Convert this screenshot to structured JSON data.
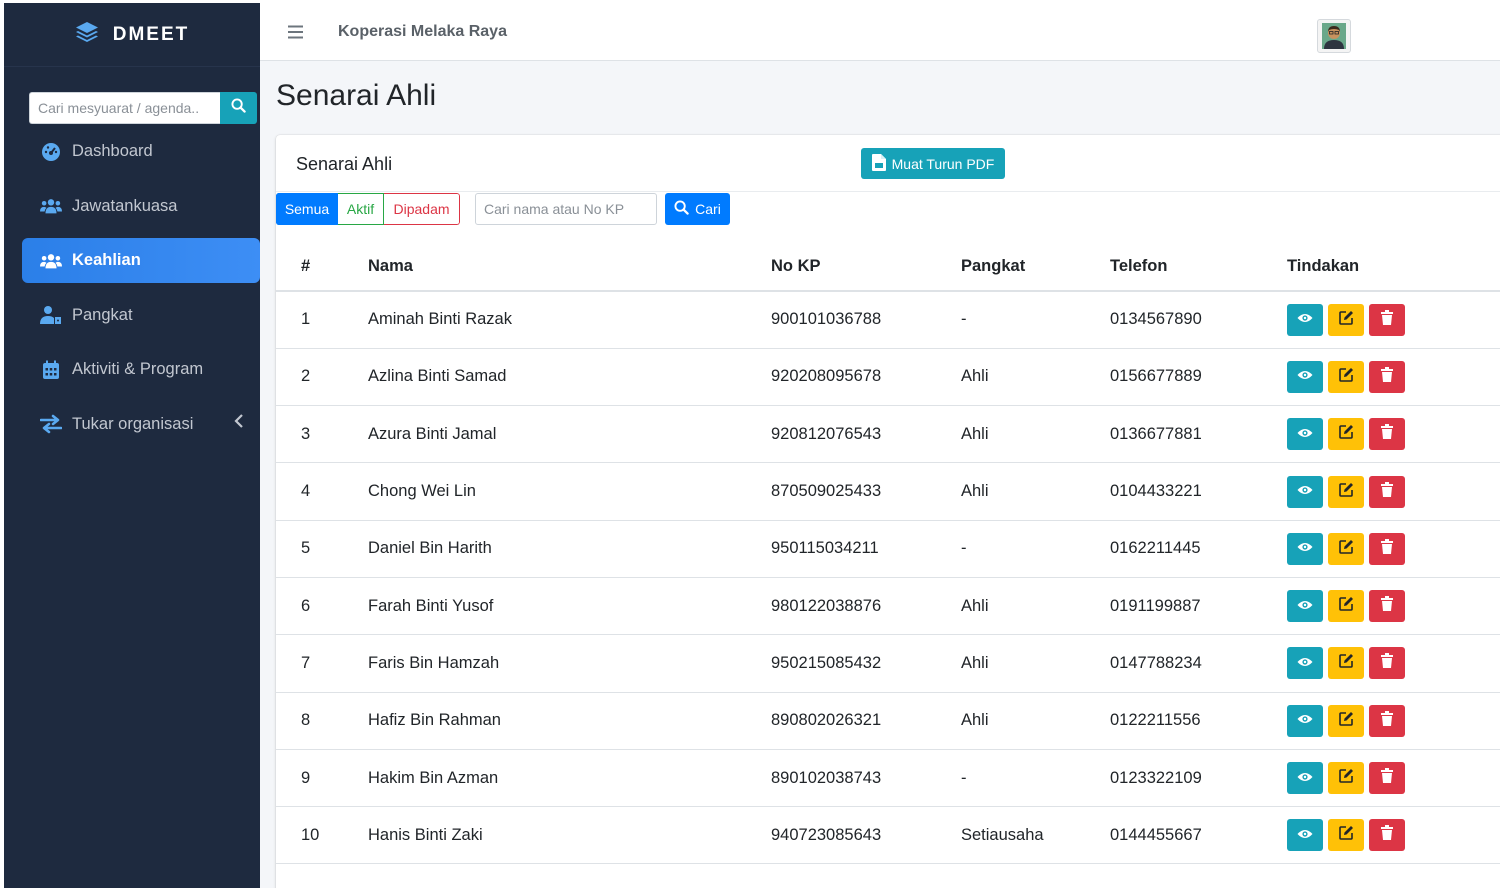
{
  "sidebar": {
    "brand": "DMEET",
    "search_placeholder": "Cari mesyuarat / agenda..",
    "items": [
      {
        "label": "Dashboard",
        "icon": "gauge-icon",
        "active": false
      },
      {
        "label": "Jawatankuasa",
        "icon": "users-icon",
        "active": false
      },
      {
        "label": "Keahlian",
        "icon": "users-icon",
        "active": true
      },
      {
        "label": "Pangkat",
        "icon": "user-tag-icon",
        "active": false
      },
      {
        "label": "Aktiviti & Program",
        "icon": "calendar-icon",
        "active": false
      },
      {
        "label": "Tukar organisasi",
        "icon": "exchange-icon",
        "active": false
      }
    ]
  },
  "topbar": {
    "org_name": "Koperasi Melaka Raya"
  },
  "page": {
    "title": "Senarai Ahli"
  },
  "card": {
    "title": "Senarai Ahli",
    "pdf_button": "Muat Turun PDF",
    "filters": {
      "all": "Semua",
      "active": "Aktif",
      "deleted": "Dipadam"
    },
    "search_placeholder": "Cari nama atau No KP",
    "search_button": "Cari"
  },
  "table": {
    "headers": [
      "#",
      "Nama",
      "No KP",
      "Pangkat",
      "Telefon",
      "Tindakan"
    ],
    "rows": [
      [
        "1",
        "Aminah Binti Razak",
        "900101036788",
        "-",
        "0134567890"
      ],
      [
        "2",
        "Azlina Binti Samad",
        "920208095678",
        "Ahli",
        "0156677889"
      ],
      [
        "3",
        "Azura Binti Jamal",
        "920812076543",
        "Ahli",
        "0136677881"
      ],
      [
        "4",
        "Chong Wei Lin",
        "870509025433",
        "Ahli",
        "0104433221"
      ],
      [
        "5",
        "Daniel Bin Harith",
        "950115034211",
        "-",
        "0162211445"
      ],
      [
        "6",
        "Farah Binti Yusof",
        "980122038876",
        "Ahli",
        "0191199887"
      ],
      [
        "7",
        "Faris Bin Hamzah",
        "950215085432",
        "Ahli",
        "0147788234"
      ],
      [
        "8",
        "Hafiz Bin Rahman",
        "890802026321",
        "Ahli",
        "0122211556"
      ],
      [
        "9",
        "Hakim Bin Azman",
        "890102038743",
        "-",
        "0123322109"
      ],
      [
        "10",
        "Hanis Binti Zaki",
        "940723085643",
        "Setiausaha",
        "0144455667"
      ]
    ]
  },
  "colors": {
    "sidebar_bg": "#1e2a3f",
    "active": "#3d8ef5",
    "info": "#17a2b8",
    "warning": "#ffc107",
    "danger": "#dc3545",
    "primary": "#007bff"
  }
}
